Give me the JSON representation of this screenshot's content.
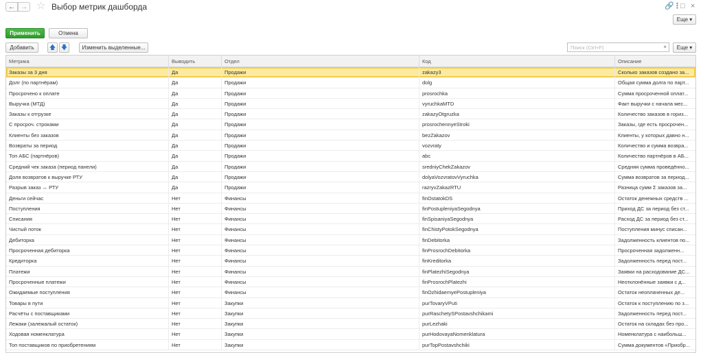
{
  "window": {
    "title": "Выбор метрик дашборда",
    "back_icon": "arrow-left-icon",
    "forward_icon": "arrow-right-icon",
    "favorite_icon": "star-icon",
    "link_icon": "link-icon",
    "more_icon": "kebab-icon",
    "restore_icon": "restore-icon",
    "close_icon": "close-icon"
  },
  "form_bar": {
    "apply_label": "Применить",
    "cancel_label": "Отмена",
    "more_label": "Еще ▾"
  },
  "toolbar": {
    "add_label": "Добавить",
    "move_up_icon": "arrow-up-icon",
    "move_down_icon": "arrow-down-icon",
    "edit_selected_label": "Изменить выделенные...",
    "more_label": "Еще ▾"
  },
  "search": {
    "placeholder": "Поиск (Ctrl+F)",
    "value": "",
    "clear_label": "×"
  },
  "colors": {
    "primary_button": "#3aa537",
    "selected_row": "#fbeaa0",
    "selected_row_border": "#f2cc4a"
  },
  "table": {
    "columns": [
      "Метрика",
      "Выводить",
      "Отдел",
      "Код",
      "Описание"
    ],
    "rows": [
      [
        "Заказы за 3 дня",
        "Да",
        "Продажи",
        "zakazy3",
        "Сколько заказов создано за..."
      ],
      [
        "Долг (по партнёрам)",
        "Да",
        "Продажи",
        "dolg",
        "Общая сумма долга по парт..."
      ],
      [
        "Просрочено к оплате",
        "Да",
        "Продажи",
        "prosrochka",
        "Сумма просроченной оплат..."
      ],
      [
        "Выручка (МТД)",
        "Да",
        "Продажи",
        "vyruchkaMTD",
        "Факт выручки с начала мес..."
      ],
      [
        "Заказы к отгрузке",
        "Да",
        "Продажи",
        "zakazyOtgruzka",
        "Количество заказов в гориз..."
      ],
      [
        "С просроч. строками",
        "Да",
        "Продажи",
        "prosrochennyeStroki",
        "Заказы, где есть просрочен..."
      ],
      [
        "Клиенты без заказов",
        "Да",
        "Продажи",
        "bezZakazov",
        "Клиенты, у которых давно н..."
      ],
      [
        "Возвраты за период",
        "Да",
        "Продажи",
        "vozvraty",
        "Количество и сумма возвра..."
      ],
      [
        "Топ АБС (партнёров)",
        "Да",
        "Продажи",
        "abc",
        "Количество партнёров в АБ..."
      ],
      [
        "Средний чек заказа (период панели)",
        "Да",
        "Продажи",
        "sredniyChekZakazov",
        "Средняя сумма проведённо..."
      ],
      [
        "Доля возвратов к выручке РТУ",
        "Да",
        "Продажи",
        "dolyaVozvratovVyruchka",
        "Сумма возвратов за период..."
      ],
      [
        "Разрыв заказ ↔ РТУ",
        "Да",
        "Продажи",
        "razryvZakazRTU",
        "Разница сумм Σ заказов за..."
      ],
      [
        "Деньги сейчас",
        "Нет",
        "Финансы",
        "finOstatokDS",
        "Остаток денежных средств ..."
      ],
      [
        "Поступления",
        "Нет",
        "Финансы",
        "finPostupleniyaSegodnya",
        "Приход ДС за период без ст..."
      ],
      [
        "Списания",
        "Нет",
        "Финансы",
        "finSpisaniyaSegodnya",
        "Расход ДС за период без ст..."
      ],
      [
        "Чистый поток",
        "Нет",
        "Финансы",
        "finChistyPotokSegodnya",
        "Поступления минус списан..."
      ],
      [
        "Дебиторка",
        "Нет",
        "Финансы",
        "finDebitorka",
        "Задолженность клиентов по..."
      ],
      [
        "Просроченная дебиторка",
        "Нет",
        "Финансы",
        "finProsrochDebitorka",
        "Просроченная задолженн..."
      ],
      [
        "Кредиторка",
        "Нет",
        "Финансы",
        "finKreditorka",
        "Задолженность перед пост..."
      ],
      [
        "Платежи",
        "Нет",
        "Финансы",
        "finPlatezhiSegodnya",
        "Заявки на расходование ДС..."
      ],
      [
        "Просроченные платежи",
        "Нет",
        "Финансы",
        "finProsrochPlatezhi",
        "Неотклонённые заявки с д..."
      ],
      [
        "Ожидаемые поступления",
        "Нет",
        "Финансы",
        "finOzhidaemyePostupleniya",
        "Остаток неоплаченных де..."
      ],
      [
        "Товары в пути",
        "Нет",
        "Закупки",
        "purTovaryVPuti",
        "Остаток к поступлению по з..."
      ],
      [
        "Расчёты с поставщиками",
        "Нет",
        "Закупки",
        "purRaschetySPostavshchikami",
        "Задолженность перед пост..."
      ],
      [
        "Лежаки (залежалый остаток)",
        "Нет",
        "Закупки",
        "purLezhaki",
        "Остаток на складах без про..."
      ],
      [
        "Ходовая номенклатура",
        "Нет",
        "Закупки",
        "purHodovayaNomenklatura",
        "Номенклатура с наибольш..."
      ],
      [
        "Топ поставщиков по приобретениям",
        "Нет",
        "Закупки",
        "purTopPostavshchiki",
        "Сумма документов «Приобр..."
      ]
    ],
    "selected_index": 0
  }
}
